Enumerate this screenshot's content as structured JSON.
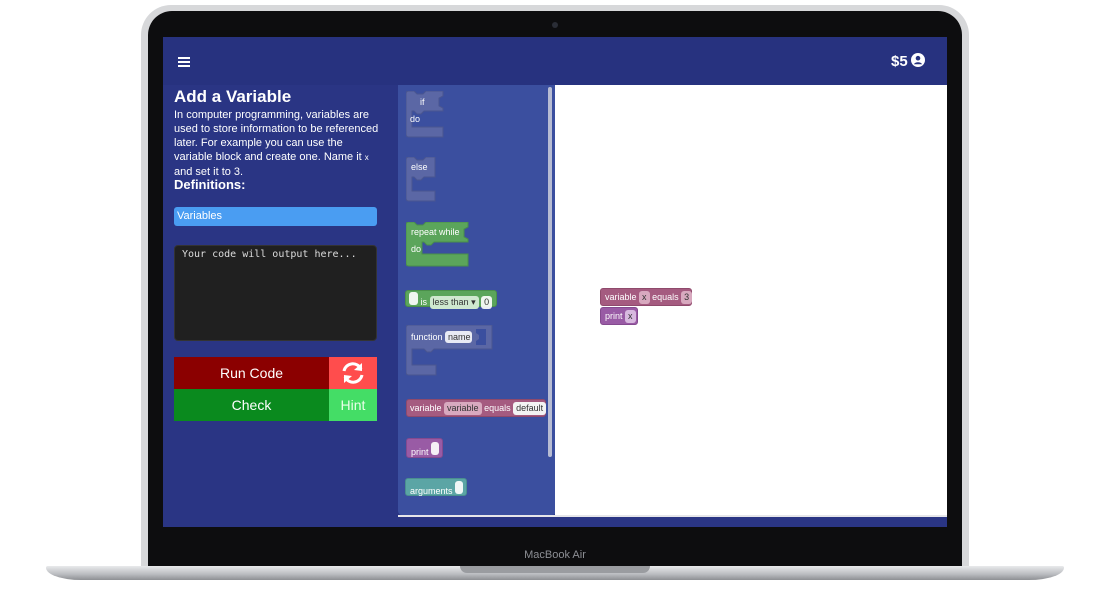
{
  "device": {
    "label": "MacBook Air"
  },
  "header": {
    "coins": "$5",
    "menu_icon": "hamburger-menu-icon",
    "user_icon": "user-account-icon"
  },
  "lesson": {
    "title": "Add a Variable",
    "desc_part1": "In computer programming, variables are used to store information to be referenced later. For example you can use the variable block and create one. Name it",
    "desc_var": "x",
    "desc_part2": "and set it to 3.",
    "definitions_label": "Definitions:",
    "definition_item": "Variables"
  },
  "output": {
    "placeholder": "Your code will output here..."
  },
  "buttons": {
    "run": "Run Code",
    "check": "Check",
    "hint": "Hint",
    "refresh_icon": "refresh-icon"
  },
  "toolbox": {
    "if_label": "if",
    "do_label": "do",
    "else_label": "else",
    "repeat_label": "repeat while",
    "repeat_do": "do",
    "is_label": "is",
    "compare_op": "less than",
    "compare_value": "0",
    "function_label": "function",
    "function_name": "name",
    "variable_label": "variable",
    "variable_name": "variable",
    "equals_label": "equals",
    "default_value": "default",
    "print_label": "print",
    "arguments_label": "arguments"
  },
  "workspace": {
    "variable_label": "variable",
    "var_name": "x",
    "equals_label": "equals",
    "value": "3",
    "print_label": "print",
    "print_arg": "x"
  },
  "colors": {
    "screen_bg": "#2a3584",
    "run_button": "#8b0000",
    "check_button": "#0a8a1e",
    "hint_button": "#44dd66",
    "refresh_button": "#ff4d4d",
    "variables_chip": "#4a9df2",
    "logic_block": "#5b67a5",
    "loop_block": "#5ba55b",
    "variable_block": "#a55b80",
    "print_block": "#995ba5",
    "arguments_block": "#5ba5a5"
  }
}
